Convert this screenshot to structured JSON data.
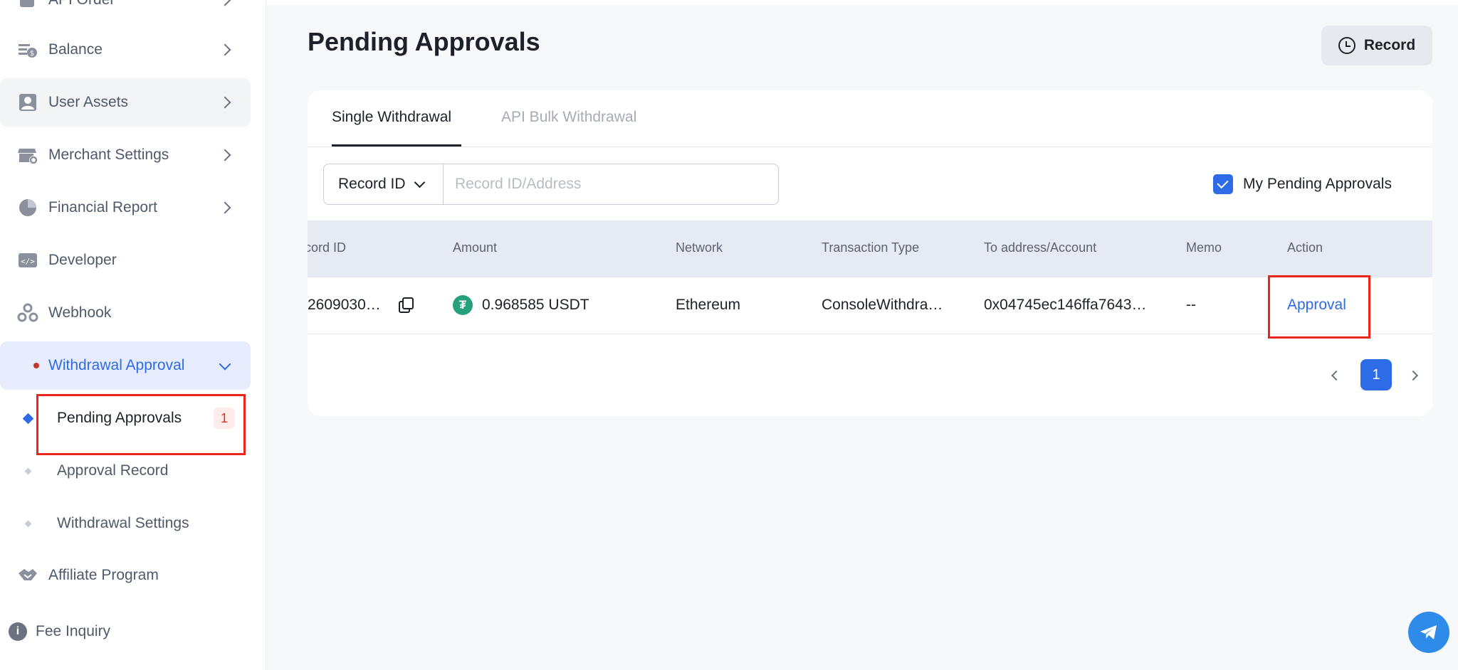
{
  "sidebar": {
    "items": [
      {
        "label": "API Order"
      },
      {
        "label": "Balance"
      },
      {
        "label": "User Assets"
      },
      {
        "label": "Merchant Settings"
      },
      {
        "label": "Financial Report"
      },
      {
        "label": "Developer"
      },
      {
        "label": "Webhook"
      },
      {
        "label": "Withdrawal Approval"
      }
    ],
    "sub_items": [
      {
        "label": "Pending Approvals",
        "badge": "1"
      },
      {
        "label": "Approval Record"
      },
      {
        "label": "Withdrawal Settings"
      }
    ],
    "affiliate": "Affiliate Program",
    "fee_inquiry": "Fee Inquiry"
  },
  "header": {
    "title": "Pending Approvals",
    "record_button": "Record"
  },
  "tabs": [
    {
      "label": "Single Withdrawal",
      "active": true
    },
    {
      "label": "API Bulk Withdrawal",
      "active": false
    }
  ],
  "filter": {
    "select_label": "Record ID",
    "placeholder": "Record ID/Address",
    "checkbox_label": "My Pending Approvals",
    "checkbox_checked": true
  },
  "table": {
    "columns": [
      "cord ID",
      "Amount",
      "Network",
      "Transaction Type",
      "To address/Account",
      "Memo",
      "Action"
    ],
    "rows": [
      {
        "record_id": "2609030…",
        "amount": "0.968585 USDT",
        "network": "Ethereum",
        "type": "ConsoleWithdra…",
        "address": "0x04745ec146ffa7643…",
        "memo": "--",
        "action": "Approval"
      }
    ]
  },
  "pagination": {
    "current": "1"
  },
  "colors": {
    "accent": "#2e6be6",
    "highlight_box": "#e8261c",
    "usdt": "#26a17b"
  }
}
